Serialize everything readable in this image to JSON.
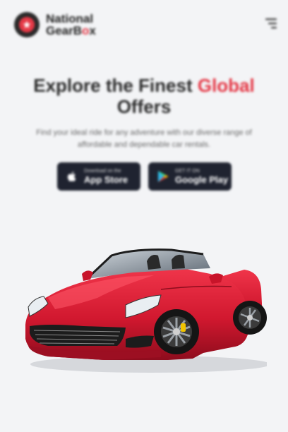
{
  "header": {
    "logo_line1": "National",
    "logo_line2_prefix": "GearB",
    "logo_line2_accent": "o",
    "logo_line2_suffix": "x",
    "menu_icon": "menu-icon"
  },
  "hero": {
    "title_part1": "Explore the Finest ",
    "title_accent": "Global",
    "title_part2": "Offers",
    "subtitle": "Find your ideal ride for any adventure with our diverse range of affordable and dependable car rentals."
  },
  "stores": {
    "apple_small": "Download on the",
    "apple_big": "App Store",
    "google_small": "GET IT ON",
    "google_big": "Google Play"
  },
  "colors": {
    "accent": "#e53846",
    "button_bg": "#1f2330",
    "background": "#f3f4f6"
  }
}
